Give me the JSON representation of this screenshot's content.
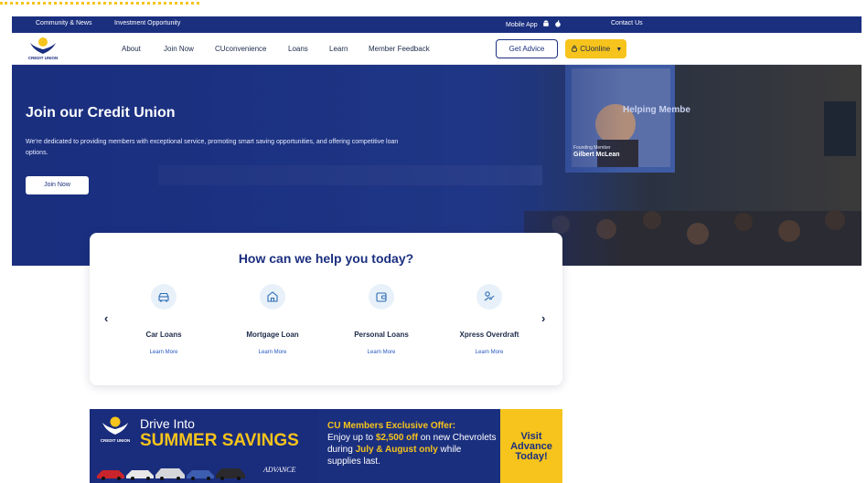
{
  "topbar": {
    "community": "Community & News",
    "investment": "Investment Opportunity",
    "mobile_app": "Mobile App",
    "contact": "Contact Us"
  },
  "logo": {
    "text": "CREDIT UNION"
  },
  "nav": {
    "items": [
      "About",
      "Join Now",
      "CUconvenience",
      "Loans",
      "Learn",
      "Member Feedback"
    ],
    "get_advice": "Get Advice",
    "cuonline": "CUonline"
  },
  "hero": {
    "title": "Join our Credit Union",
    "description": "We're dedicated to providing members with exceptional service, promoting smart saving opportunities, and offering competitive loan options.",
    "button": "Join Now",
    "screen_text_1": "Helping Membe",
    "screen_text_2": "Founding Member",
    "screen_text_3": "Gilbert McLean"
  },
  "help": {
    "title": "How can we help you today?",
    "prev": "‹",
    "next": "›",
    "services": [
      {
        "name": "Car Loans",
        "more": "Learn More",
        "icon": "car-icon"
      },
      {
        "name": "Mortgage Loan",
        "more": "Learn More",
        "icon": "house-icon"
      },
      {
        "name": "Personal Loans",
        "more": "Learn More",
        "icon": "wallet-icon"
      },
      {
        "name": "Xpress Overdraft",
        "more": "Learn More",
        "icon": "hand-coin-icon"
      }
    ]
  },
  "banner": {
    "drive": "Drive Into",
    "summer": "SUMMER SAVINGS",
    "logo_text": "CREDIT UNION",
    "advance": "ADVANCE",
    "offer_title": "CU Members Exclusive Offer:",
    "offer_1": "Enjoy up to ",
    "offer_amount": "$2,500 off",
    "offer_2": " on new Chevrolets during ",
    "offer_months": "July & August",
    "offer_3": " ",
    "offer_only": "only",
    "offer_4": " while supplies last.",
    "cta_1": "Visit",
    "cta_2": "Advance",
    "cta_3": "Today!"
  },
  "colors": {
    "brand_navy": "#1b2f7f",
    "accent_yellow": "#f6c41c",
    "link_blue": "#2456c4"
  }
}
